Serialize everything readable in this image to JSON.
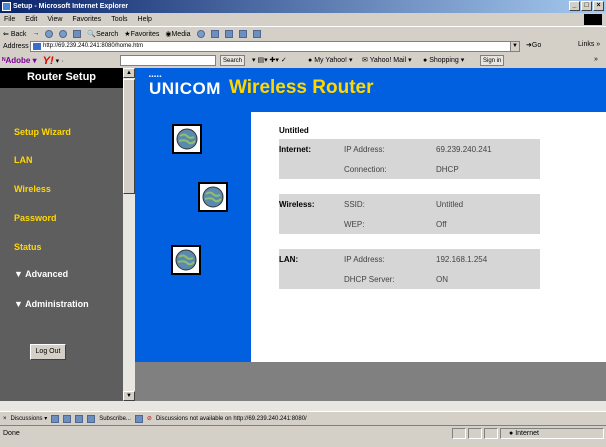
{
  "window": {
    "title": "Setup - Microsoft Internet Explorer"
  },
  "menu": [
    "File",
    "Edit",
    "View",
    "Favorites",
    "Tools",
    "Help"
  ],
  "toolbar": {
    "back": "Back",
    "search": "Search",
    "favorites": "Favorites",
    "media": "Media"
  },
  "address": {
    "label": "Address",
    "url": "http://69.239.240.241:8080/home.htm",
    "go": "Go",
    "links": "Links"
  },
  "yahoo": {
    "brand": "Adobe",
    "search_btn": "Search",
    "my_yahoo": "My Yahoo!",
    "mail": "Yahoo! Mail",
    "shopping": "Shopping",
    "signin": "Sign in"
  },
  "sidebar": {
    "title": "Router Setup",
    "items": [
      "Setup Wizard",
      "LAN",
      "Wireless",
      "Password",
      "Status",
      "▼ Advanced",
      "▼ Administration"
    ],
    "logout": "Log Out"
  },
  "banner": {
    "brand": "UNICOM",
    "product": "Wireless Router"
  },
  "info": {
    "name": "Untitled",
    "sections": [
      {
        "label": "Internet:",
        "rows": [
          {
            "k": "IP Address:",
            "v": "69.239.240.241"
          },
          {
            "k": "Connection:",
            "v": "DHCP"
          }
        ]
      },
      {
        "label": "Wireless:",
        "rows": [
          {
            "k": "SSID:",
            "v": "Untitled"
          },
          {
            "k": "WEP:",
            "v": "Off"
          }
        ]
      },
      {
        "label": "LAN:",
        "rows": [
          {
            "k": "IP Address:",
            "v": "192.168.1.254"
          },
          {
            "k": "DHCP Server:",
            "v": "ON"
          }
        ]
      }
    ]
  },
  "discussions": {
    "label": "Discussions",
    "subscribe": "Subscribe...",
    "msg": "Discussions not available on http://69.239.240.241:8080/"
  },
  "status": {
    "text": "Done",
    "zone": "Internet"
  }
}
